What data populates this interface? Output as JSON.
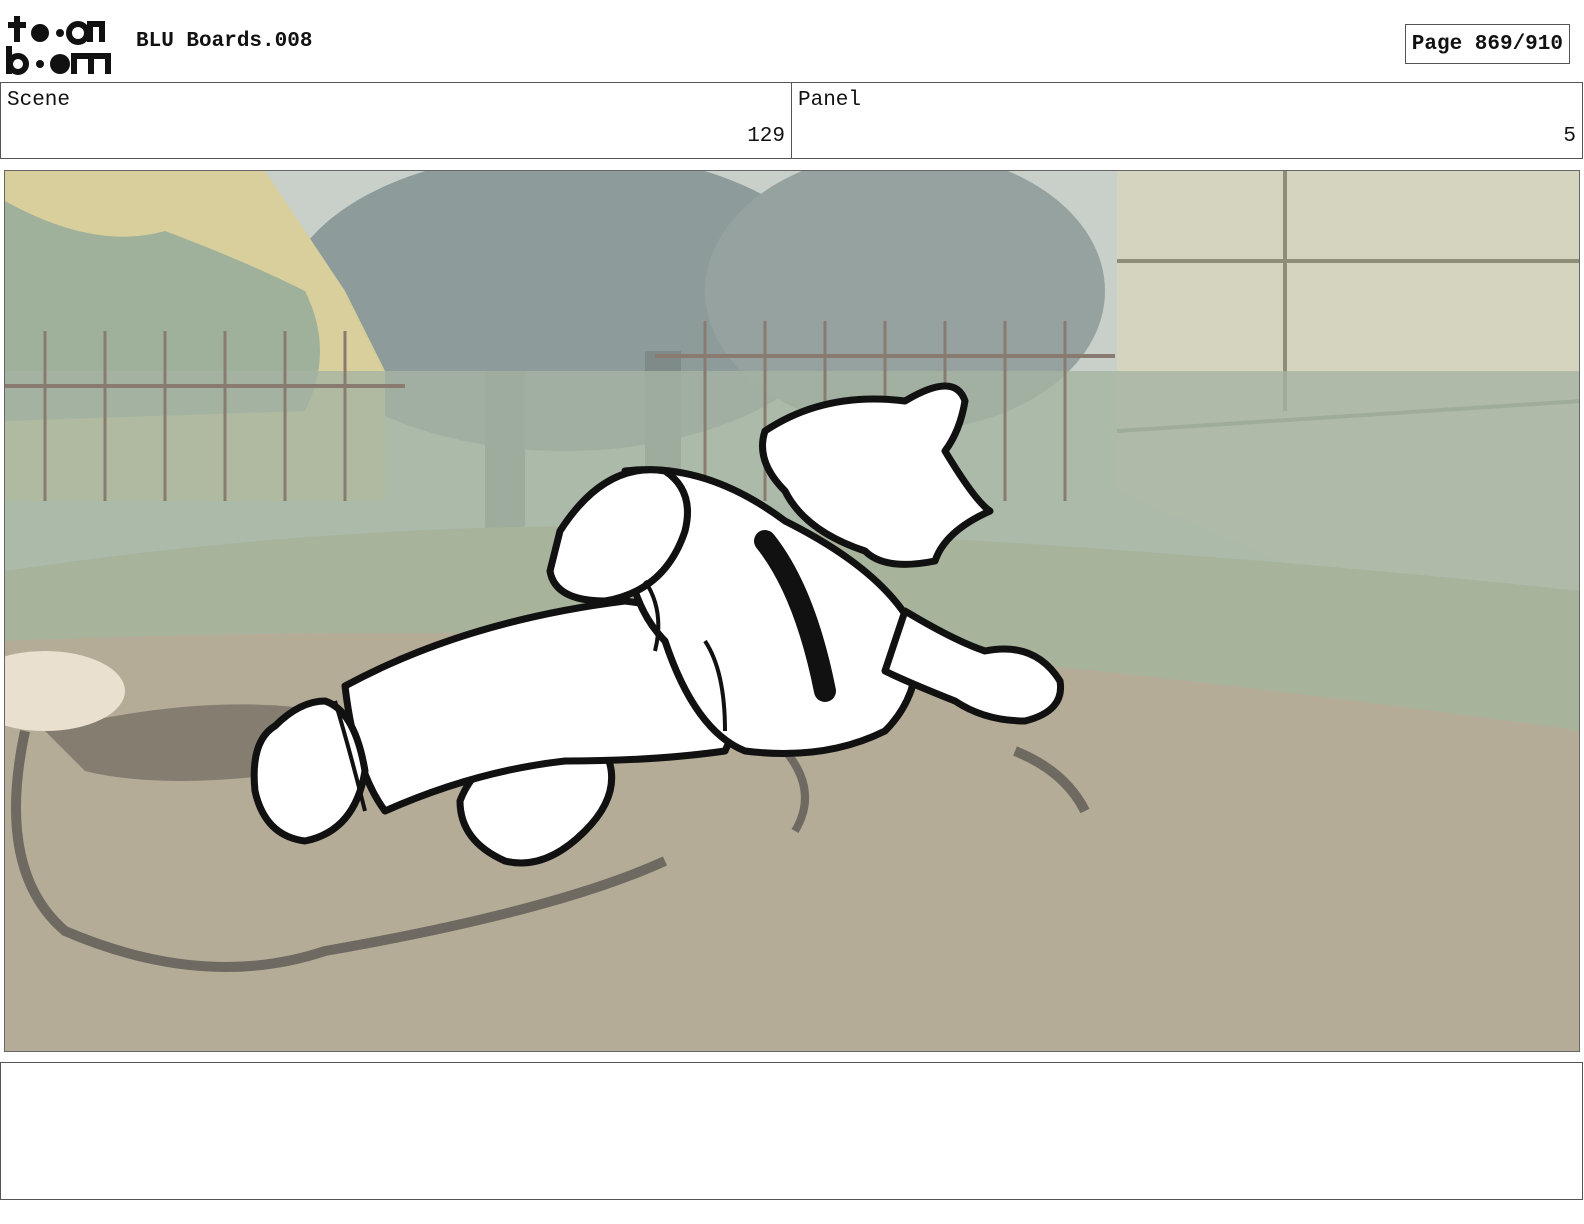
{
  "header": {
    "logo_text": "toon boom",
    "title": "BLU Boards.008",
    "page_label": "Page 869/910"
  },
  "scene": {
    "label": "Scene",
    "value": "129"
  },
  "panel": {
    "label": "Panel",
    "value": "5"
  },
  "image": {
    "icon": "storyboard-sketch"
  },
  "notes": {
    "text": ""
  }
}
